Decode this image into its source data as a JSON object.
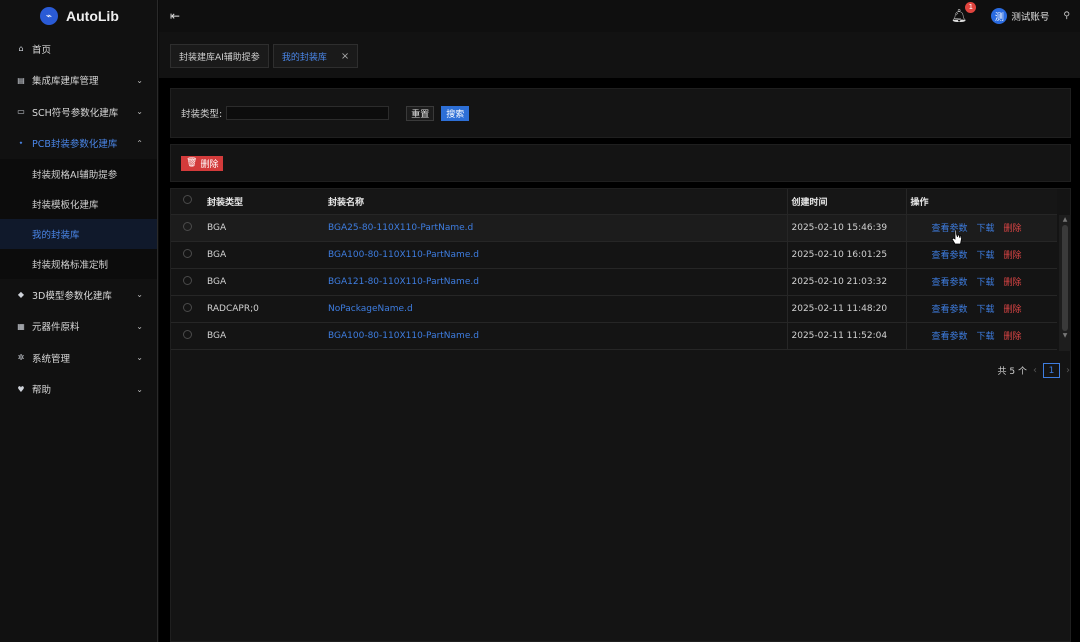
{
  "app": {
    "name": "AutoLib"
  },
  "sidebar": {
    "items": [
      {
        "icon": "home-icon",
        "label": "首页",
        "has_chevron": false
      },
      {
        "icon": "chip-icon",
        "label": "集成库建库管理",
        "has_chevron": true
      },
      {
        "icon": "schematic-icon",
        "label": "SCH符号参数化建库",
        "has_chevron": true
      },
      {
        "icon": "pcb-icon",
        "label": "PCB封装参数化建库",
        "has_chevron": true,
        "open": true
      }
    ],
    "sub_items": [
      {
        "label": "封装规格AI辅助提参",
        "active": false
      },
      {
        "label": "封装模板化建库",
        "active": false
      },
      {
        "label": "我的封装库",
        "active": true
      },
      {
        "label": "封装规格标准定制",
        "active": false
      }
    ],
    "items_after": [
      {
        "icon": "cube-icon",
        "label": "3D模型参数化建库",
        "has_chevron": true
      },
      {
        "icon": "component-icon",
        "label": "元器件原料",
        "has_chevron": true
      },
      {
        "icon": "gear-icon",
        "label": "系统管理",
        "has_chevron": true
      },
      {
        "icon": "heart-icon",
        "label": "帮助",
        "has_chevron": true
      }
    ]
  },
  "topbar": {
    "notifications_count": "1",
    "user_avatar_text": "测",
    "user_name": "测试账号"
  },
  "tabs": [
    {
      "label": "封装建库AI辅助提参",
      "active": false,
      "closable": false
    },
    {
      "label": "我的封装库",
      "active": true,
      "closable": true
    }
  ],
  "search": {
    "label": "封装类型:",
    "value": "",
    "reset_label": "重置",
    "search_label": "搜索"
  },
  "actions": {
    "delete_label": "删除"
  },
  "table": {
    "headers": {
      "type": "封装类型",
      "name": "封装名称",
      "time": "创建时间",
      "ops": "操作"
    },
    "rows": [
      {
        "type": "BGA",
        "name": "BGA25-80-110X110-PartName.d",
        "time": "2025-02-10 15:46:39"
      },
      {
        "type": "BGA",
        "name": "BGA100-80-110X110-PartName.d",
        "time": "2025-02-10 16:01:25"
      },
      {
        "type": "BGA",
        "name": "BGA121-80-110X110-PartName.d",
        "time": "2025-02-10 21:03:32"
      },
      {
        "type": "RADCAPR;0",
        "name": "NoPackageName.d",
        "time": "2025-02-11 11:48:20"
      },
      {
        "type": "BGA",
        "name": "BGA100-80-110X110-PartName.d",
        "time": "2025-02-11 11:52:04"
      }
    ],
    "ops": {
      "view": "查看参数",
      "download": "下载",
      "delete": "删除"
    }
  },
  "pagination": {
    "total_text": "共 5 个",
    "current_page": "1"
  },
  "colors": {
    "accent": "#2d6fd6",
    "danger": "#d33b3b",
    "link": "#3e7de0"
  }
}
